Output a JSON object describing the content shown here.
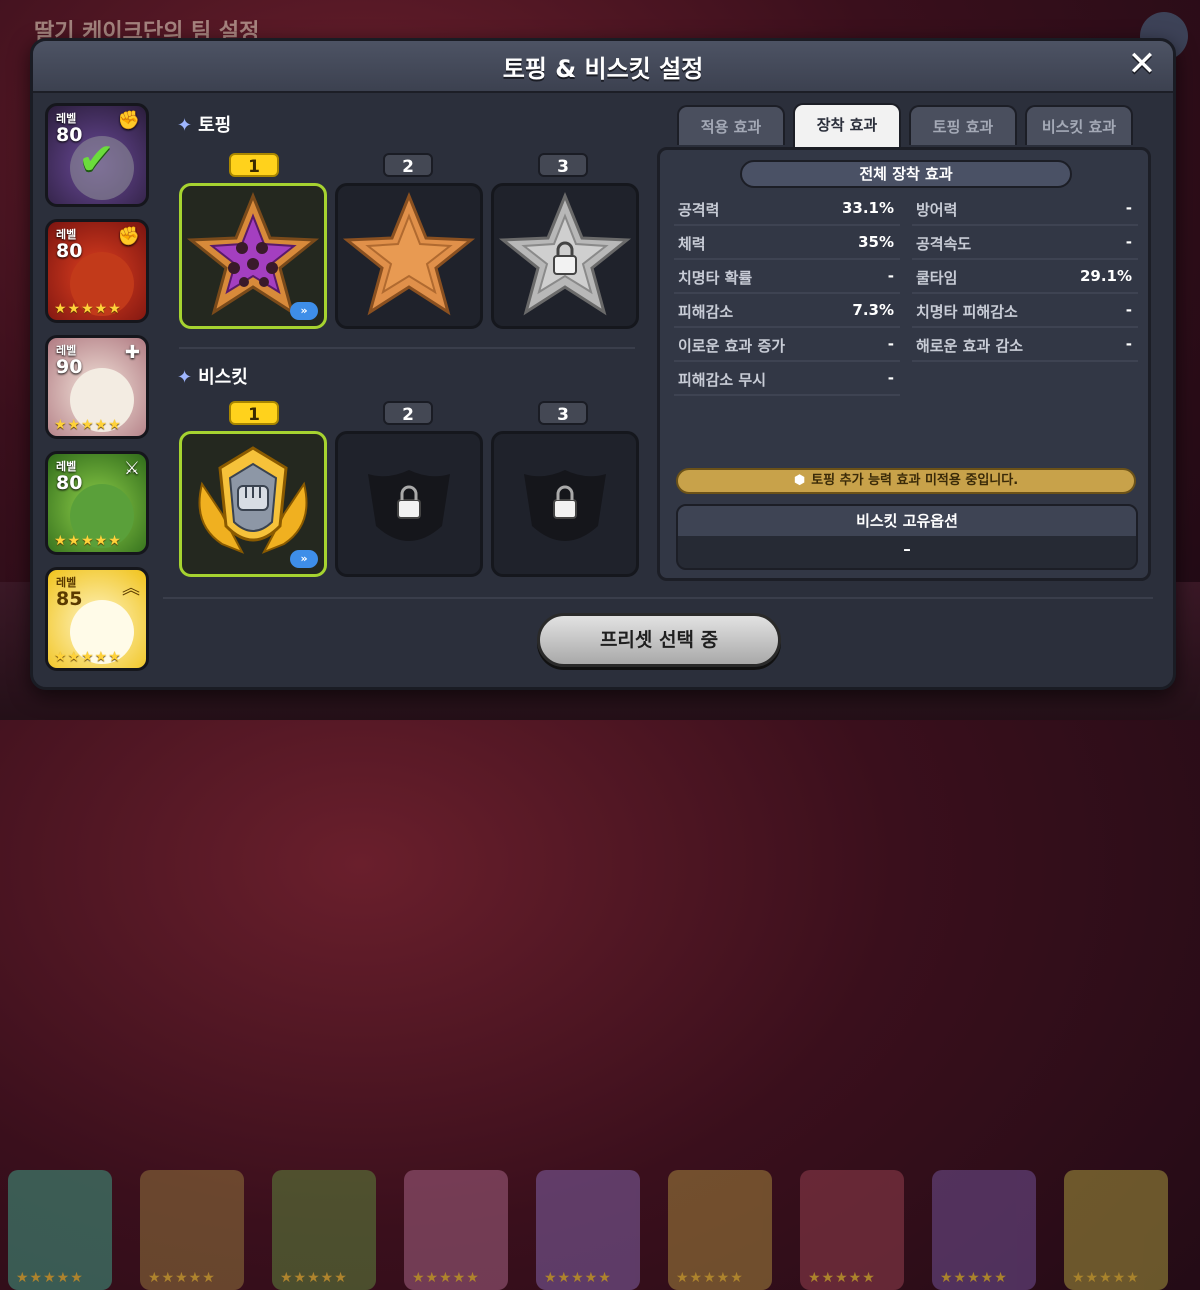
{
  "background": {
    "title": "딸기 케이크단의 팀 설정"
  },
  "dialog": {
    "title": "토핑 & 비스킷 설정"
  },
  "cookies": [
    {
      "level_label": "레벨",
      "level": "80",
      "class_icon": "fist-icon",
      "selected": true,
      "stars": ""
    },
    {
      "level_label": "레벨",
      "level": "80",
      "class_icon": "fist-icon",
      "selected": false,
      "stars": "★★★★★"
    },
    {
      "level_label": "레벨",
      "level": "90",
      "class_icon": "plus-icon",
      "selected": false,
      "stars": "★★★★★"
    },
    {
      "level_label": "레벨",
      "level": "80",
      "class_icon": "sword-icon",
      "selected": false,
      "stars": "★★★★★"
    },
    {
      "level_label": "레벨",
      "level": "85",
      "class_icon": "chevron-up-icon",
      "selected": false,
      "stars": "★★★★★"
    }
  ],
  "toppings": {
    "section_label": "토핑",
    "slots": [
      {
        "number": "1",
        "active": true,
        "state": "equipped"
      },
      {
        "number": "2",
        "active": false,
        "state": "empty"
      },
      {
        "number": "3",
        "active": false,
        "state": "locked"
      }
    ]
  },
  "biscuits": {
    "section_label": "비스킷",
    "slots": [
      {
        "number": "1",
        "active": true,
        "state": "equipped"
      },
      {
        "number": "2",
        "active": false,
        "state": "locked"
      },
      {
        "number": "3",
        "active": false,
        "state": "locked"
      }
    ]
  },
  "tabs": [
    {
      "label": "적용 효과",
      "active": false
    },
    {
      "label": "장착 효과",
      "active": true
    },
    {
      "label": "토핑 효과",
      "active": false
    },
    {
      "label": "비스킷 효과",
      "active": false
    }
  ],
  "effects": {
    "header": "전체 장착 효과",
    "stats_left": [
      {
        "label": "공격력",
        "value": "33.1%"
      },
      {
        "label": "체력",
        "value": "35%"
      },
      {
        "label": "치명타 확률",
        "value": "-"
      },
      {
        "label": "피해감소",
        "value": "7.3%"
      },
      {
        "label": "이로운 효과 증가",
        "value": "-"
      },
      {
        "label": "피해감소 무시",
        "value": "-"
      }
    ],
    "stats_right": [
      {
        "label": "방어력",
        "value": "-"
      },
      {
        "label": "공격속도",
        "value": "-"
      },
      {
        "label": "쿨타임",
        "value": "29.1%"
      },
      {
        "label": "치명타 피해감소",
        "value": "-"
      },
      {
        "label": "해로운 효과 감소",
        "value": "-"
      }
    ],
    "notice": "토핑 추가 능력 효과 미적용 중입니다.",
    "unique_title": "비스킷 고유옵션",
    "unique_value": "–"
  },
  "footer": {
    "preset_button": "프리셋 선택 중"
  },
  "colors": {
    "accent_yellow": "#ffd21c",
    "selected_green": "#a6d330",
    "panel": "#2b2f3b"
  }
}
